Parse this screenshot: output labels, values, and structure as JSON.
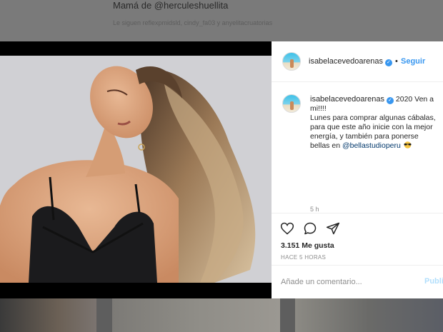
{
  "background": {
    "bio_text": "Mamá de @herculeshuellita",
    "followed_by_text": "Le siguen reflexpmidsld, cindy_fa03 y anyelitacruatorias"
  },
  "post": {
    "author": {
      "username": "isabelacevedoarenas",
      "verified_mark": "✓",
      "avatar_icon": "beach-avatar"
    },
    "header": {
      "separator": "•",
      "follow_label": "Seguir"
    },
    "caption": {
      "username": "isabelacevedoarenas",
      "verified_mark": "✓",
      "first_line": "2020 Ven a mi!!!!",
      "body": "Lunes para comprar algunas cábalas, para que este año inicie con la mejor energía, y también para ponerse bellas en",
      "mention": "@bellastudioperu",
      "emoji_icon": "sunglasses-emoji",
      "time_ago": "5 h"
    },
    "actions": {
      "like_icon": "heart-icon",
      "comment_icon": "comment-bubble-icon",
      "share_icon": "share-plane-icon"
    },
    "likes_text": "3.151 Me gusta",
    "posted_text": "HACE 5 HORAS",
    "comment": {
      "placeholder": "Añade un comentario...",
      "publish_label": "Publicar"
    }
  },
  "colors": {
    "accent": "#3897f0",
    "mention": "#00376b",
    "muted": "#8e8e8e",
    "text": "#262626"
  }
}
